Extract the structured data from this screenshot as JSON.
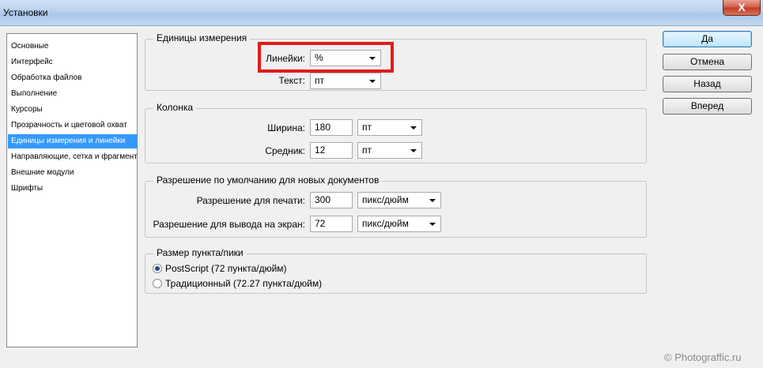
{
  "window": {
    "title": "Установки",
    "close_glyph": "X"
  },
  "sidebar": {
    "items": [
      {
        "label": "Основные"
      },
      {
        "label": "Интерфейс"
      },
      {
        "label": "Обработка файлов"
      },
      {
        "label": "Выполнение"
      },
      {
        "label": "Курсоры"
      },
      {
        "label": "Прозрачность и цветовой охват"
      },
      {
        "label": "Единицы измерения и линейки",
        "selected": true
      },
      {
        "label": "Направляющие, сетка и фрагменты"
      },
      {
        "label": "Внешние модули"
      },
      {
        "label": "Шрифты"
      }
    ]
  },
  "units": {
    "legend": "Единицы измерения",
    "rulers_label": "Линейки:",
    "rulers_value": "%",
    "text_label": "Текст:",
    "text_value": "пт"
  },
  "column": {
    "legend": "Колонка",
    "width_label": "Ширина:",
    "width_value": "180",
    "width_unit": "пт",
    "gutter_label": "Средник:",
    "gutter_value": "12",
    "gutter_unit": "пт"
  },
  "resolution": {
    "legend": "Разрешение по умолчанию для новых документов",
    "print_label": "Разрешение для печати:",
    "print_value": "300",
    "print_unit": "пикс/дюйм",
    "screen_label": "Разрешение для вывода на экран:",
    "screen_value": "72",
    "screen_unit": "пикс/дюйм"
  },
  "point_size": {
    "legend": "Размер пункта/пики",
    "postscript_label": "PostScript (72 пункта/дюйм)",
    "postscript_selected": true,
    "traditional_label": "Традиционный (72.27 пункта/дюйм)",
    "traditional_selected": false
  },
  "buttons": {
    "ok": "Да",
    "cancel": "Отмена",
    "back": "Назад",
    "next": "Вперед"
  },
  "watermark": "© Photograffic.ru",
  "colors": {
    "selection": "#3399ff",
    "highlight": "#e31b1b",
    "close": "#c23c24"
  }
}
